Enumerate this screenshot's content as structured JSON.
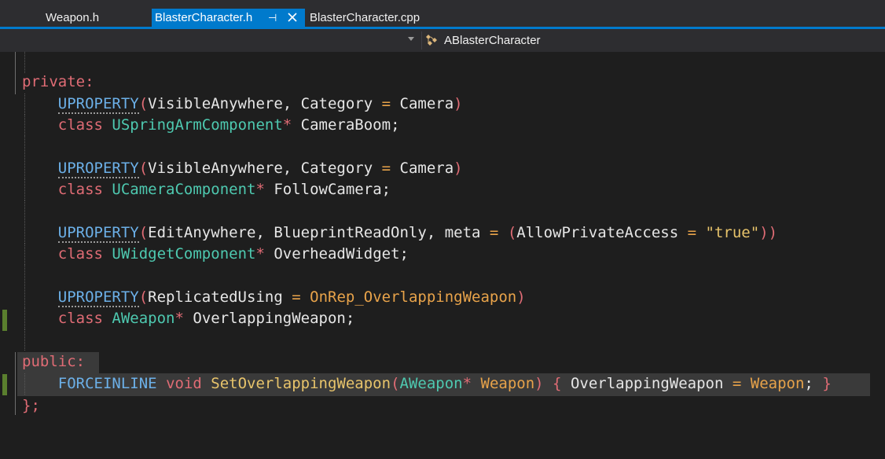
{
  "tabs": [
    {
      "label": "Weapon.h",
      "active": false
    },
    {
      "label": "BlasterCharacter.h",
      "active": true,
      "pin_glyph": "⊣"
    },
    {
      "label": "BlasterCharacter.cpp",
      "active": false
    }
  ],
  "nav": {
    "scope": "ABlasterCharacter",
    "scope_icon": "class-icon"
  },
  "colors": {
    "accent": "#007acc",
    "keyword": "#e06c75",
    "macro": "#6cb0e8",
    "type": "#4ec9b0",
    "function": "#e8c46b",
    "change_marker": "#5a7f2e"
  },
  "code": {
    "l1_private": "private:",
    "l2_macro": "UPROPERTY",
    "l2_args": "VisibleAnywhere",
    "l2_cat": "Category",
    "l2_eq": "=",
    "l2_val": "Camera",
    "l3_class": "class",
    "l3_type": "USpringArmComponent",
    "l3_ptr": "*",
    "l3_name": "CameraBoom",
    "l5_macro": "UPROPERTY",
    "l5_args": "VisibleAnywhere",
    "l5_cat": "Category",
    "l5_eq": "=",
    "l5_val": "Camera",
    "l6_class": "class",
    "l6_type": "UCameraComponent",
    "l6_ptr": "*",
    "l6_name": "FollowCamera",
    "l8_macro": "UPROPERTY",
    "l8_a1": "EditAnywhere",
    "l8_a2": "BlueprintReadOnly",
    "l8_a3": "meta",
    "l8_eq1": "=",
    "l8_a4": "AllowPrivateAccess",
    "l8_eq2": "=",
    "l8_str": "\"true\"",
    "l9_class": "class",
    "l9_type": "UWidgetComponent",
    "l9_ptr": "*",
    "l9_name": "OverheadWidget",
    "l11_macro": "UPROPERTY",
    "l11_arg": "ReplicatedUsing",
    "l11_eq": "=",
    "l11_val": "OnRep_OverlappingWeapon",
    "l12_class": "class",
    "l12_type": "AWeapon",
    "l12_ptr": "*",
    "l12_name": "OverlappingWeapon",
    "l14_public": "public:",
    "l15_macro": "FORCEINLINE",
    "l15_void": "void",
    "l15_fn": "SetOverlappingWeapon",
    "l15_type": "AWeapon",
    "l15_ptr": "*",
    "l15_param": "Weapon",
    "l15_lb": "{",
    "l15_var": "OverlappingWeapon",
    "l15_eq": "=",
    "l15_param2": "Weapon",
    "l15_rb": "}",
    "l16_end": "};"
  }
}
